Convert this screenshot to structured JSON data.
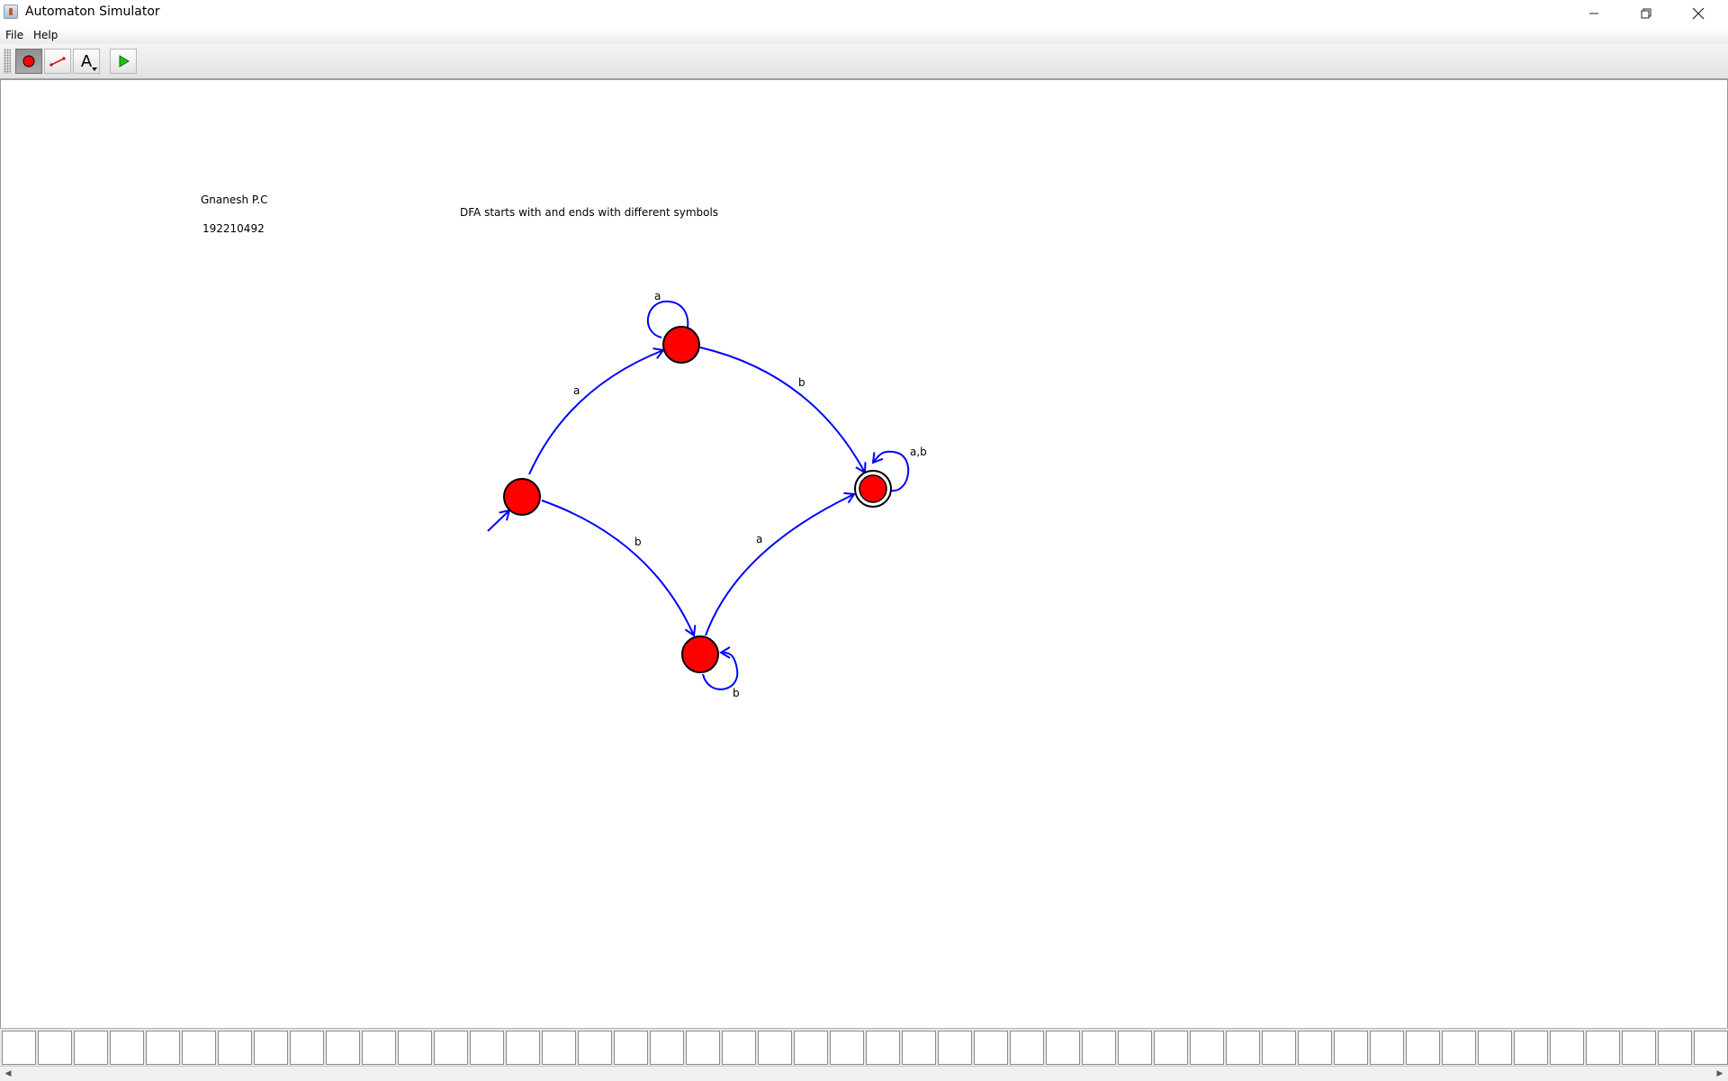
{
  "window": {
    "title": "Automaton Simulator",
    "controls": [
      "minimize-icon",
      "restore-icon",
      "close-icon"
    ]
  },
  "menu": {
    "items": [
      {
        "label": "File"
      },
      {
        "label": "Help"
      }
    ]
  },
  "toolbar": {
    "tools": [
      {
        "name": "state-tool",
        "icon": "red-circle-icon",
        "active": true
      },
      {
        "name": "transition-tool",
        "icon": "transition-line-icon",
        "active": false
      },
      {
        "name": "text-tool",
        "icon": "text-a-icon",
        "label": "A",
        "active": false
      },
      {
        "name": "run-tool",
        "icon": "play-icon",
        "active": false
      }
    ]
  },
  "canvas": {
    "annotations": {
      "author": "Gnanesh P.C",
      "id": "192210492",
      "caption": "DFA starts with and ends with different symbols"
    },
    "automaton": {
      "states": [
        {
          "id": "q0",
          "initial": true,
          "accepting": false,
          "color": "#ff0000"
        },
        {
          "id": "q1",
          "initial": false,
          "accepting": false,
          "color": "#ff0000"
        },
        {
          "id": "q2",
          "initial": false,
          "accepting": true,
          "color": "#ff0000"
        },
        {
          "id": "q3",
          "initial": false,
          "accepting": false,
          "color": "#ff0000"
        }
      ],
      "transitions": [
        {
          "from": "q0",
          "to": "q1",
          "label": "a"
        },
        {
          "from": "q1",
          "to": "q1",
          "label": "a"
        },
        {
          "from": "q1",
          "to": "q2",
          "label": "b"
        },
        {
          "from": "q0",
          "to": "q3",
          "label": "b"
        },
        {
          "from": "q3",
          "to": "q3",
          "label": "b"
        },
        {
          "from": "q3",
          "to": "q2",
          "label": "a"
        },
        {
          "from": "q2",
          "to": "q2",
          "label": "a,b"
        }
      ],
      "edge_color": "#0000ff"
    }
  },
  "tape": {
    "cells": [
      "",
      "",
      "",
      "",
      "",
      "",
      "",
      "",
      "",
      "",
      "",
      "",
      "",
      "",
      "",
      "",
      "",
      "",
      "",
      "",
      "",
      "",
      "",
      "",
      "",
      "",
      "",
      "",
      "",
      "",
      "",
      "",
      "",
      "",
      "",
      "",
      "",
      "",
      "",
      "",
      "",
      "",
      "",
      "",
      "",
      "",
      "",
      ""
    ]
  }
}
